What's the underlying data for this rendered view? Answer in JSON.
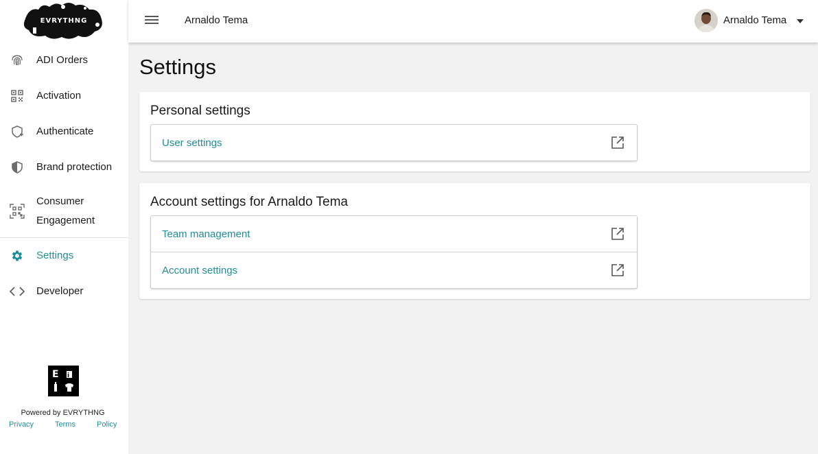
{
  "brand": {
    "logo_text": "EVRYTHNG",
    "badge_letters": [
      "E",
      "i"
    ],
    "powered_by": "Powered by EVRYTHNG",
    "footer_links": [
      "Privacy",
      "Terms",
      "Policy"
    ]
  },
  "sidebar": {
    "items": [
      {
        "label": "ADI Orders",
        "icon": "fingerprint-icon"
      },
      {
        "label": "Activation",
        "icon": "qr-code-icon"
      },
      {
        "label": "Authenticate",
        "icon": "shield-plus-icon"
      },
      {
        "label": "Brand protection",
        "icon": "shield-half-icon"
      },
      {
        "label": "Consumer",
        "label2": "Engagement",
        "icon": "qr-scan-icon"
      },
      {
        "label": "Settings",
        "icon": "gear-icon",
        "active": true
      },
      {
        "label": "Developer",
        "icon": "code-icon"
      }
    ]
  },
  "topbar": {
    "title": "Arnaldo Tema",
    "user_name": "Arnaldo Tema"
  },
  "main": {
    "page_title": "Settings",
    "personal": {
      "heading": "Personal settings",
      "links": [
        "User settings"
      ]
    },
    "account": {
      "heading": "Account settings for Arnaldo Tema",
      "links": [
        "Team management",
        "Account settings"
      ]
    }
  },
  "colors": {
    "accent": "#1f8c99",
    "background": "#f2f2f2",
    "surface": "#ffffff"
  }
}
